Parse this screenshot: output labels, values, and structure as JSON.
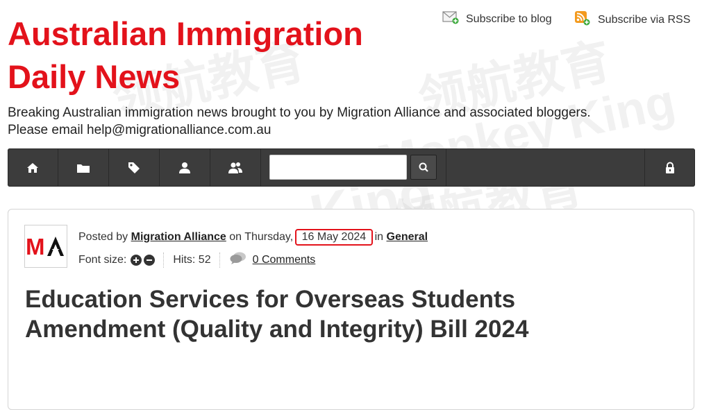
{
  "site": {
    "title_line1": "Australian Immigration",
    "title_line2": "Daily News",
    "tagline_line1": "Breaking Australian immigration news brought to you by Migration Alliance and associated bloggers.",
    "tagline_line2": "Please email help@migrationalliance.com.au"
  },
  "subscribe": {
    "blog_label": "Subscribe to blog",
    "rss_label": "Subscribe via RSS"
  },
  "nav": {
    "items": [
      "home-icon",
      "folder-icon",
      "tag-icon",
      "user-icon",
      "users-icon"
    ],
    "search_value": "",
    "search_icon": "search-icon",
    "lock_icon": "lock-icon"
  },
  "article": {
    "logo_text": "MA",
    "posted_by_prefix": "Posted by",
    "author": "Migration Alliance",
    "on_prefix": "on Thursday,",
    "date": "16 May 2024",
    "in_prefix": "in",
    "category": "General",
    "font_size_label": "Font size:",
    "hits_label": "Hits: 52",
    "comments": "0 Comments",
    "title": "Education Services for Overseas Students Amendment (Quality and Integrity) Bill 2024"
  },
  "colors": {
    "brand_red": "#e3121b",
    "nav_bg": "#3c3c3c",
    "highlight": "#e3121b"
  }
}
